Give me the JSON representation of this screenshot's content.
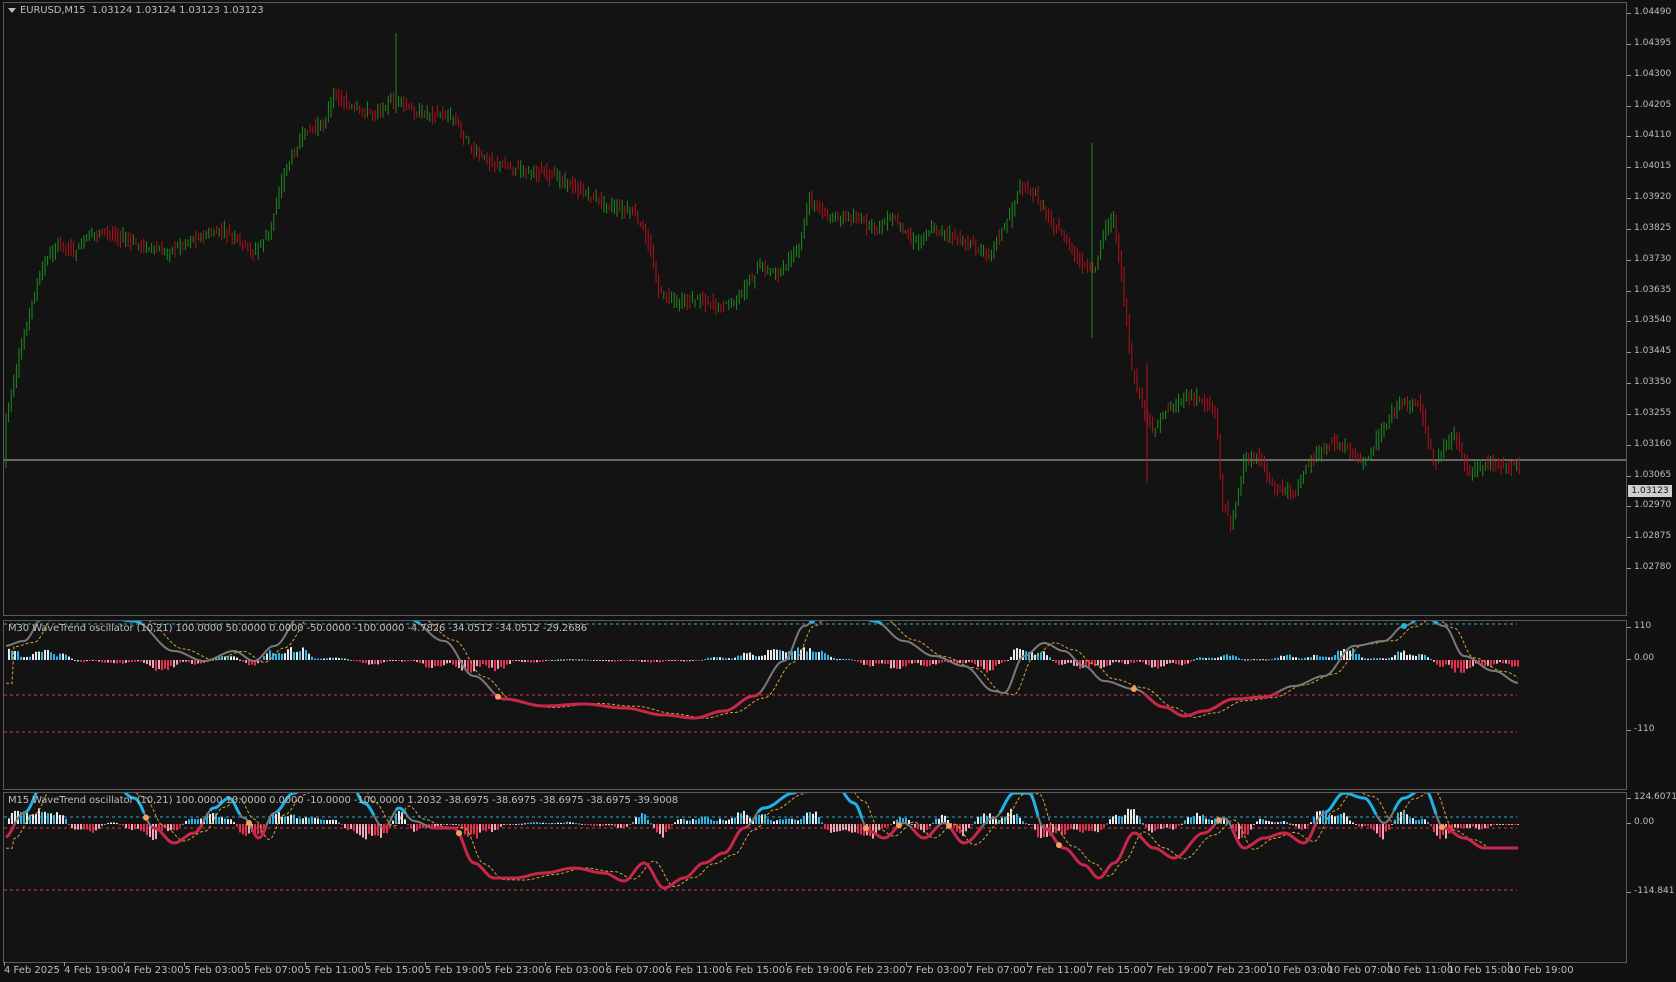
{
  "main": {
    "symbol": "EURUSD,M15",
    "ohlc": "1.03124 1.03124 1.03123 1.03123",
    "current_price": "1.03123",
    "price_scale": [
      "1.04490",
      "1.04395",
      "1.04300",
      "1.04205",
      "1.04110",
      "1.04015",
      "1.03920",
      "1.03825",
      "1.03730",
      "1.03635",
      "1.03540",
      "1.03445",
      "1.03350",
      "1.03255",
      "1.03160",
      "1.03065",
      "1.02970",
      "1.02875",
      "1.02780"
    ],
    "colors": {
      "up": "#1f8c1f",
      "down": "#b0121e",
      "background": "#131313"
    }
  },
  "osc1": {
    "title": "M30 WaveTrend oscillator (10,21) 100.0000 50.0000 0.0000 -50.0000 -100.0000 -4.7826 -34.0512 -34.0512 -29.2686",
    "scale": [
      "110",
      "0.00",
      "-110"
    ]
  },
  "osc2": {
    "title": "M15 WaveTrend oscillator (10,21) 100.0000 10.0000 0.0000 -10.0000 -100.0000 1.2032 -38.6975 -38.6975 -38.6975 -38.6975 -39.9008",
    "scale": [
      "124.6071",
      "0.00",
      "-114.841"
    ]
  },
  "time_axis": [
    "4 Feb 2025",
    "4 Feb 19:00",
    "4 Feb 23:00",
    "5 Feb 03:00",
    "5 Feb 07:00",
    "5 Feb 11:00",
    "5 Feb 15:00",
    "5 Feb 19:00",
    "5 Feb 23:00",
    "6 Feb 03:00",
    "6 Feb 07:00",
    "6 Feb 11:00",
    "6 Feb 15:00",
    "6 Feb 19:00",
    "6 Feb 23:00",
    "7 Feb 03:00",
    "7 Feb 07:00",
    "7 Feb 11:00",
    "7 Feb 15:00",
    "7 Feb 19:00",
    "7 Feb 23:00",
    "10 Feb 03:00",
    "10 Feb 07:00",
    "10 Feb 11:00",
    "10 Feb 15:00",
    "10 Feb 19:00"
  ],
  "colors": {
    "wt_bull": "#20b2e6",
    "wt_bear": "#c8264a",
    "wt_neutral": "#7a7a7a",
    "signal": "#d9a23a",
    "ob_line": "#2aa9d6",
    "os_line": "#d6334d",
    "hist_pos": "#2fb4e8",
    "hist_neg": "#e0304f"
  }
}
